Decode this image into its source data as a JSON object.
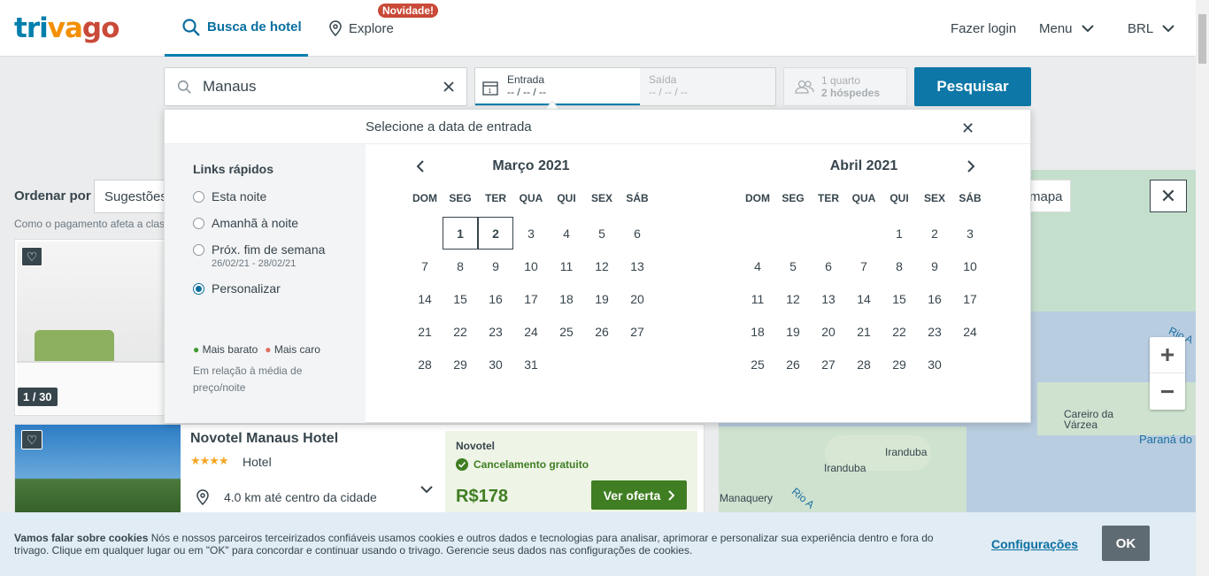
{
  "header": {
    "logo": [
      "tri",
      "va",
      "go"
    ],
    "tab_hotel": "Busca de hotel",
    "tab_explore": "Explore",
    "badge_new": "Novidade!",
    "login": "Fazer login",
    "menu": "Menu",
    "currency": "BRL"
  },
  "search": {
    "destination": "Manaus",
    "checkin_label": "Entrada",
    "checkin_value": "-- / -- / --",
    "checkout_label": "Saída",
    "checkout_value": "-- / -- / --",
    "rooms": "1 quarto",
    "guests": "2 hóspedes",
    "button": "Pesquisar"
  },
  "results": {
    "sort_label": "Ordenar por",
    "sort_value": "Sugestões",
    "sort_hint": "Como o pagamento afeta a clas",
    "photo_counter": "1 / 30",
    "hotel": {
      "name": "Novotel Manaus Hotel",
      "stars": "★★★★",
      "type": "Hotel",
      "distance": "4.0 km até centro da cidade",
      "partner": "Novotel",
      "cancel": "Cancelamento gratuito",
      "price": "R$178",
      "offer_button": "Ver oferta"
    }
  },
  "map": {
    "show_button": "mapa",
    "labels": [
      "Careiro da Várzea",
      "Paraná do",
      "Iranduba",
      "Iranduba",
      "Manaquery",
      "Rio A",
      "Rio A"
    ]
  },
  "datepicker": {
    "title": "Selecione a data de entrada",
    "quick_title": "Links rápidos",
    "options": [
      {
        "label": "Esta noite",
        "sub": ""
      },
      {
        "label": "Amanhã à noite",
        "sub": ""
      },
      {
        "label": "Próx. fim de semana",
        "sub": "26/02/21 - 28/02/21"
      },
      {
        "label": "Personalizar",
        "sub": ""
      }
    ],
    "legend_cheap": "Mais barato",
    "legend_expensive": "Mais caro",
    "legend_note": "Em relação à média de preço/noite",
    "weekdays": [
      "DOM",
      "SEG",
      "TER",
      "QUA",
      "QUI",
      "SEX",
      "SÁB"
    ],
    "months": [
      {
        "title": "Março 2021",
        "offset": 1,
        "days": 31,
        "selected": [
          1,
          2
        ]
      },
      {
        "title": "Abril 2021",
        "offset": 4,
        "days": 30,
        "selected": []
      }
    ]
  },
  "cookie": {
    "title": "Vamos falar sobre cookies",
    "text": "Nós e nossos parceiros terceirizados confiáveis usamos cookies e outros dados e tecnologias para analisar, aprimorar e personalizar sua experiência dentro e fora do trivago. Clique em qualquer lugar ou em \"OK\" para concordar e continuar usando o trivago. Gerencie seus dados nas configurações de cookies.",
    "settings": "Configurações",
    "ok": "OK"
  }
}
